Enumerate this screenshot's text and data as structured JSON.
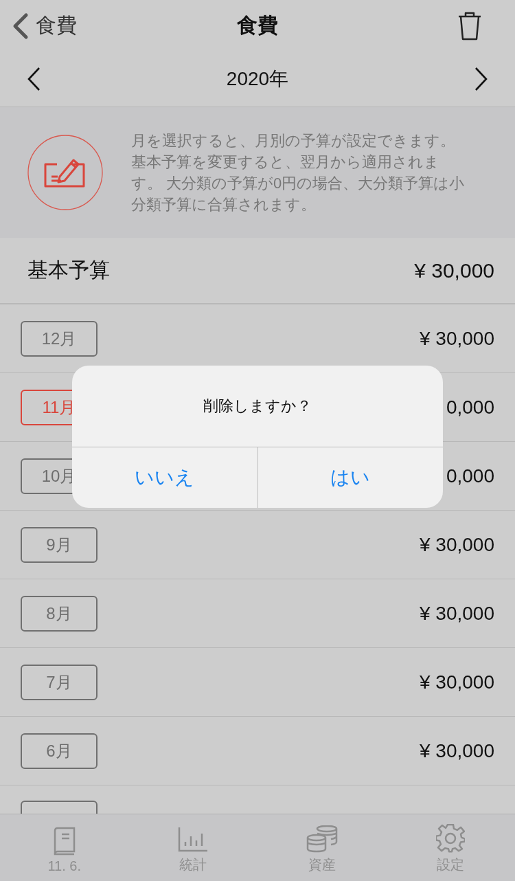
{
  "nav": {
    "back_label": "食費",
    "title": "食費"
  },
  "year": "2020年",
  "info": "月を選択すると、月別の予算が設定できます。基本予算を変更すると、翌月から適用されます。 大分類の予算が0円の場合、大分類予算は小分類予算に合算されます。",
  "base_budget": {
    "label": "基本予算",
    "amount": "¥ 30,000"
  },
  "months": [
    {
      "label": "12月",
      "amount": "¥ 30,000",
      "selected": false
    },
    {
      "label": "11月",
      "amount": "0,000",
      "selected": true
    },
    {
      "label": "10月",
      "amount": "0,000",
      "selected": false
    },
    {
      "label": "9月",
      "amount": "¥ 30,000",
      "selected": false
    },
    {
      "label": "8月",
      "amount": "¥ 30,000",
      "selected": false
    },
    {
      "label": "7月",
      "amount": "¥ 30,000",
      "selected": false
    },
    {
      "label": "6月",
      "amount": "¥ 30,000",
      "selected": false
    }
  ],
  "dialog": {
    "message": "削除しますか？",
    "buttons": [
      "いいえ",
      "はい"
    ]
  },
  "tab_bar": [
    {
      "label": "11. 6.",
      "kind": "book"
    },
    {
      "label": "統計",
      "kind": "chart"
    },
    {
      "label": "資産",
      "kind": "coins"
    },
    {
      "label": "設定",
      "kind": "gear"
    }
  ]
}
